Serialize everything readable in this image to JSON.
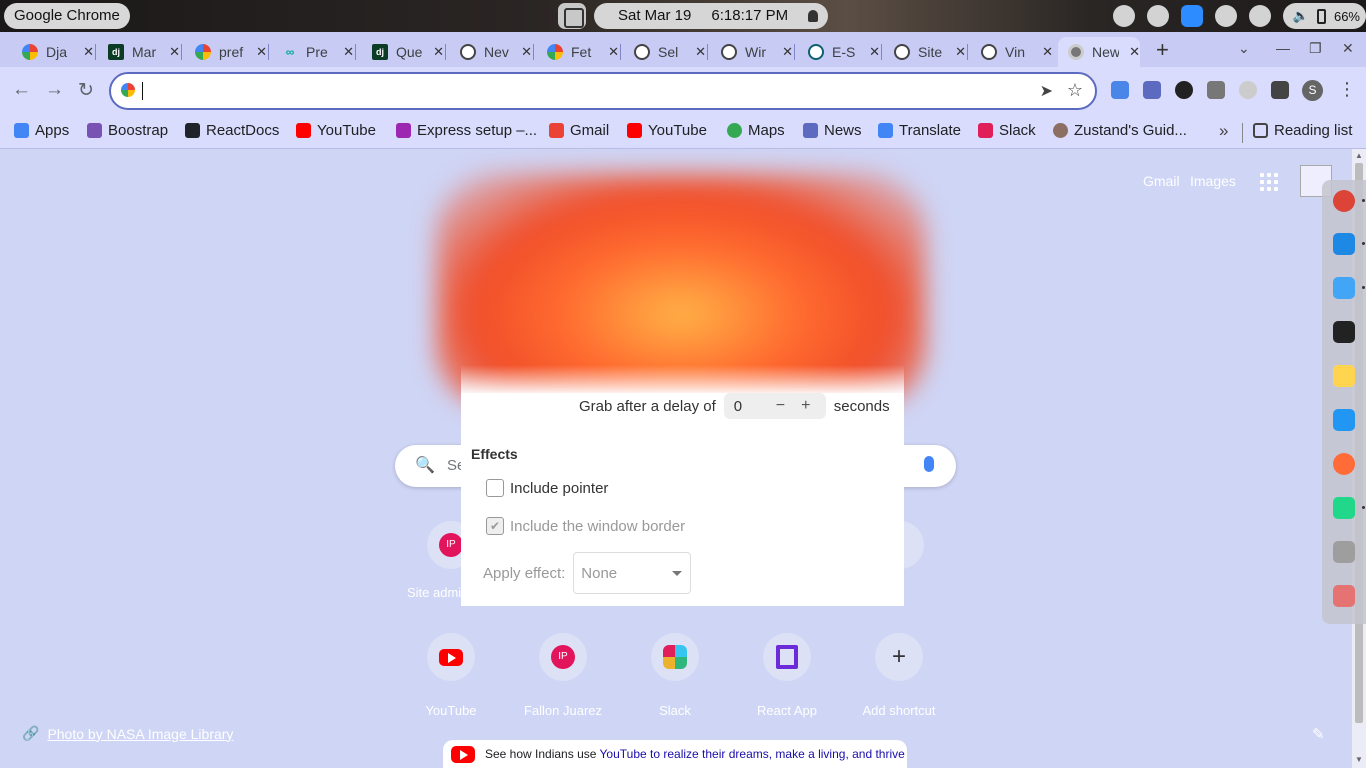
{
  "system_bar": {
    "app_name": "Google Chrome",
    "date": "Sat Mar 19",
    "time": "6:18:17 PM",
    "battery": "66%"
  },
  "tabs": [
    {
      "title": "Dja",
      "icon": "google-icon"
    },
    {
      "title": "Mar",
      "icon": "django-icon"
    },
    {
      "title": "pref",
      "icon": "google-icon"
    },
    {
      "title": "Pre",
      "icon": "link-icon"
    },
    {
      "title": "Que",
      "icon": "django-icon"
    },
    {
      "title": "Nev",
      "icon": "globe-icon"
    },
    {
      "title": "Fet",
      "icon": "google-icon"
    },
    {
      "title": "Sel",
      "icon": "globe-icon"
    },
    {
      "title": "Wir",
      "icon": "globe-icon"
    },
    {
      "title": "E-S",
      "icon": "react-icon"
    },
    {
      "title": "Site",
      "icon": "globe-icon"
    },
    {
      "title": "Vin",
      "icon": "globe-icon"
    },
    {
      "title": "New",
      "icon": "chrome-icon"
    }
  ],
  "omnibox": {
    "value": ""
  },
  "bookmarks": [
    {
      "label": "Apps",
      "color": "#4285f4"
    },
    {
      "label": "Boostrap",
      "color": "#7952b3"
    },
    {
      "label": "ReactDocs",
      "color": "#20232a"
    },
    {
      "label": "YouTube",
      "color": "#ff0000"
    },
    {
      "label": "Express setup –...",
      "color": "#9c27b0"
    },
    {
      "label": "Gmail",
      "color": "#ea4335"
    },
    {
      "label": "YouTube",
      "color": "#ff0000"
    },
    {
      "label": "Maps",
      "color": "#34a853"
    },
    {
      "label": "News",
      "color": "#5c6bc0"
    },
    {
      "label": "Translate",
      "color": "#4285f4"
    },
    {
      "label": "Slack",
      "color": "#e01e5a"
    },
    {
      "label": "Zustand's Guid...",
      "color": "#8d6e63"
    }
  ],
  "reading_list": "Reading list",
  "page": {
    "top_links": {
      "gmail": "Gmail",
      "images": "Images"
    },
    "search_placeholder": "Search Google or type a URL",
    "shortcuts_row1": [
      {
        "label": "Site admi"
      }
    ],
    "shortcuts_row2": [
      {
        "label": "YouTube"
      },
      {
        "label": "Fallon Juarez",
        "initials": "IP"
      },
      {
        "label": "Slack"
      },
      {
        "label": "React App"
      },
      {
        "label": "Add shortcut"
      }
    ],
    "row1_initials": "IP",
    "photo_credit": "Photo by NASA Image Library",
    "promo": {
      "text": "See how Indians use ",
      "link": "YouTube to realize their dreams, make a living, and thrive"
    }
  },
  "dialog": {
    "delay_label": "Grab after a delay of",
    "delay_value": "0",
    "delay_unit": "seconds",
    "effects_heading": "Effects",
    "include_pointer": "Include pointer",
    "include_border": "Include the window border",
    "apply_effect_label": "Apply effect:",
    "apply_effect_value": "None"
  },
  "dock_apps": [
    {
      "name": "chrome",
      "color": "#db4437"
    },
    {
      "name": "vscode",
      "color": "#1e88e5"
    },
    {
      "name": "finder",
      "color": "#42a5f5"
    },
    {
      "name": "terminal",
      "color": "#222222"
    },
    {
      "name": "notes",
      "color": "#ffd54f"
    },
    {
      "name": "app-store",
      "color": "#2196f3"
    },
    {
      "name": "postman",
      "color": "#ff6c37"
    },
    {
      "name": "pycharm",
      "color": "#21d789"
    },
    {
      "name": "trash",
      "color": "#9e9e9e"
    },
    {
      "name": "launchpad",
      "color": "#e57373"
    }
  ]
}
